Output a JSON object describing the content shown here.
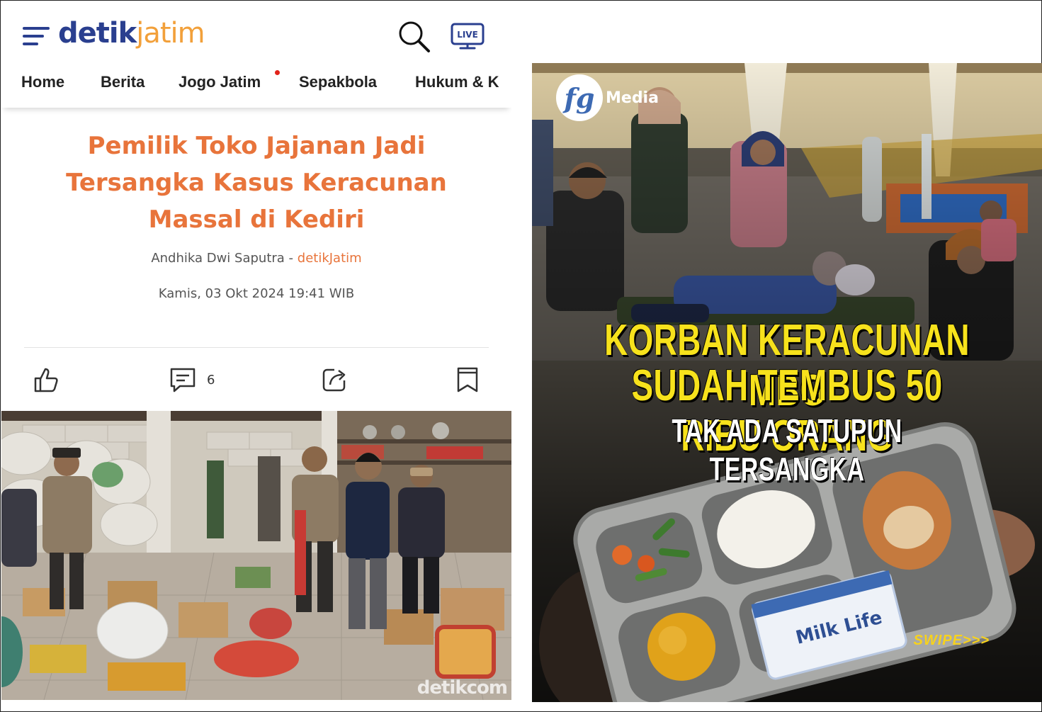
{
  "article": {
    "logo": {
      "part1": "detik",
      "part2": "jatim"
    },
    "nav": [
      "Home",
      "Berita",
      "Jogo Jatim",
      "Sepakbola",
      "Hukum & K"
    ],
    "headline_lines": [
      "Pemilik Toko Jajanan Jadi",
      "Tersangka Kasus Keracunan",
      "Massal di Kediri"
    ],
    "author": "Andhika Dwi Saputra",
    "separator": " - ",
    "source": "detikJatim",
    "date": "Kamis, 03 Okt 2024 19:41 WIB",
    "comment_count": "6",
    "live_label": "LIVE",
    "photo_watermark": "detikcom",
    "icons": [
      "menu-icon",
      "search-icon",
      "live-tv-icon",
      "like-icon",
      "comment-icon",
      "share-icon",
      "bookmark-icon"
    ],
    "colors": {
      "brand_blue": "#2a3f8f",
      "brand_orange": "#f2a03a",
      "headline": "#e8743b"
    }
  },
  "post": {
    "brand_logo": "fg",
    "brand_name": "Media",
    "headline_1": "KORBAN KERACUNAN MBG",
    "headline_2": "SUDAH TEMBUS 50 RIBU ORANG",
    "headline_3": "TAK ADA SATUPUN TERSANGKA",
    "swipe": "SWIPE>>>",
    "carton_text": "Milk Life",
    "colors": {
      "headline_yellow": "#f7e21c",
      "swipe": "#f7d21c"
    }
  }
}
